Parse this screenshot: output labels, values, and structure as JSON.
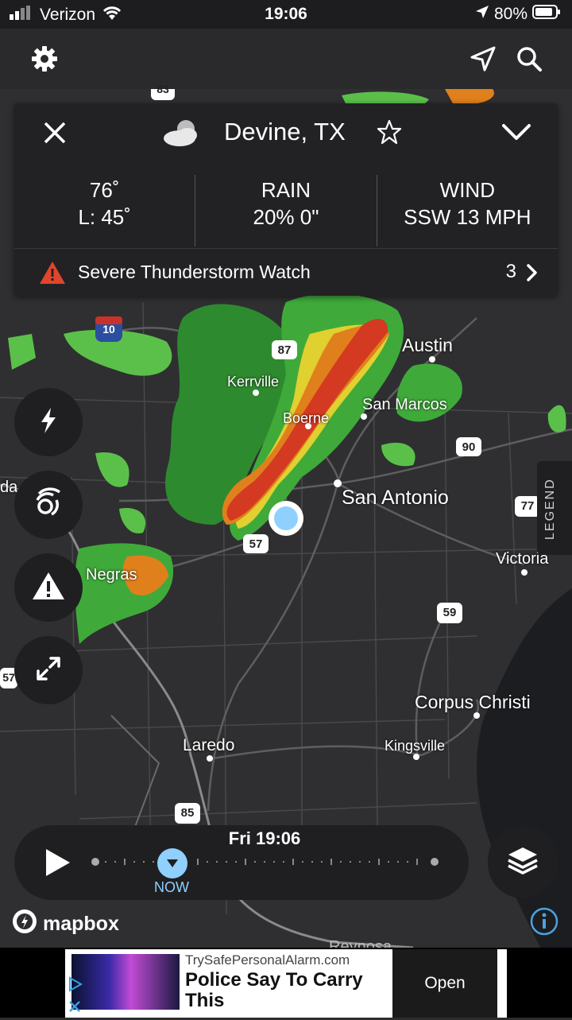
{
  "status_bar": {
    "carrier": "Verizon",
    "time": "19:06",
    "battery": "80%"
  },
  "icons": {
    "settings": "gear-icon",
    "locate": "location-arrow-icon",
    "search": "search-icon",
    "close": "close-icon",
    "weather": "partly-cloudy-icon",
    "favorite": "star-icon",
    "collapse": "chevron-down-icon",
    "alert": "warning-triangle-icon",
    "more": "chevron-right-icon",
    "lightning": "lightning-icon",
    "radar": "radar-icon",
    "warnings": "warning-icon",
    "expand": "expand-icon",
    "play": "play-icon",
    "layers": "layers-icon",
    "info": "info-icon"
  },
  "location_card": {
    "title": "Devine, TX",
    "temp": {
      "high": "76˚",
      "low": "L: 45˚"
    },
    "rain": {
      "label": "RAIN",
      "value": "20% 0\""
    },
    "wind": {
      "label": "WIND",
      "value": "SSW 13 MPH"
    },
    "alert": {
      "text": "Severe Thunderstorm Watch",
      "count": "3"
    }
  },
  "map_labels": {
    "cities": [
      "Austin",
      "Kerrville",
      "Boerne",
      "San Marcos",
      "San Antonio",
      "Victoria",
      "Negras",
      "Corpus Christi",
      "Laredo",
      "Kingsville",
      "Reynosa",
      "da"
    ],
    "highways": [
      "83",
      "10",
      "87",
      "90",
      "77",
      "57",
      "59",
      "57",
      "85"
    ]
  },
  "legend": "LEGEND",
  "timeline": {
    "time": "Fri 19:06",
    "now_label": "NOW"
  },
  "attribution": "mapbox",
  "ad": {
    "url": "TrySafePersonalAlarm.com",
    "headline": "Police Say To Carry This",
    "cta": "Open"
  },
  "colors": {
    "accent": "#8fd0ff",
    "alert": "#e0452b",
    "card": "#222224",
    "map": "#2d2d2f"
  }
}
